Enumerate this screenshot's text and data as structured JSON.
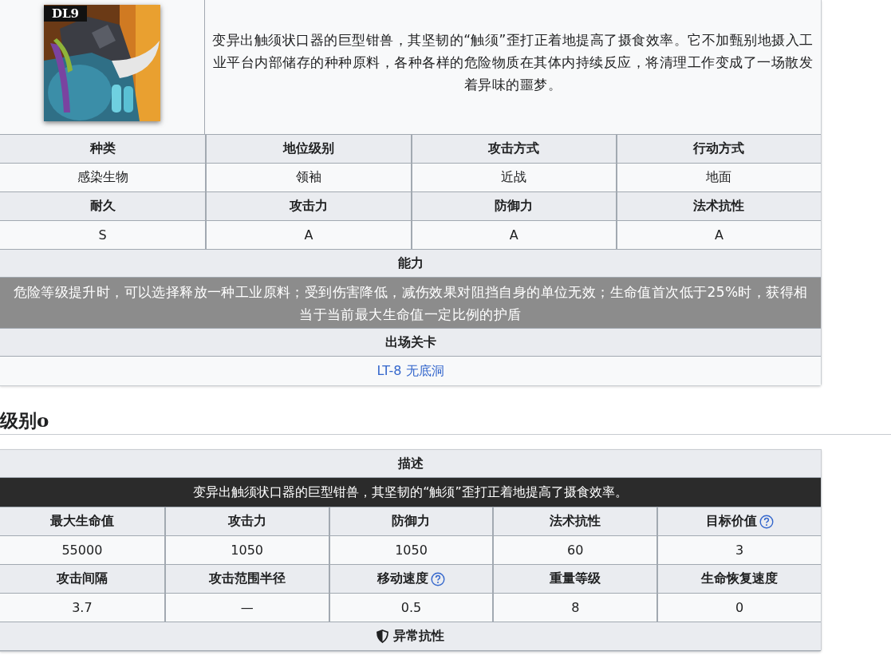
{
  "info_table": {
    "portrait": {
      "badge": "DL9"
    },
    "description": "变异出触须状口器的巨型钳兽，其坚韧的“触须”歪打正着地提高了摄食效率。它不加甄别地摄入工业平台内部储存的种种原料，各种各样的危险物质在其体内持续反应，将清理工作变成了一场散发着异味的噩梦。",
    "rows": [
      {
        "kind": "header",
        "cells": [
          "种类",
          "地位级别",
          "攻击方式",
          "行动方式"
        ]
      },
      {
        "kind": "value",
        "cells": [
          "感染生物",
          "领袖",
          "近战",
          "地面"
        ]
      },
      {
        "kind": "header",
        "cells": [
          "耐久",
          "攻击力",
          "防御力",
          "法术抗性"
        ]
      },
      {
        "kind": "value",
        "cells": [
          "S",
          "A",
          "A",
          "A"
        ]
      }
    ],
    "ability": {
      "title": "能力",
      "text": "危险等级提升时，可以选择释放一种工业原料；受到伤害降低，减伤效果对阻挡自身的单位无效；生命值首次低于25%时，获得相当于当前最大生命值一定比例的护盾"
    },
    "stage": {
      "title": "出场关卡",
      "link": "LT-8 无底洞"
    }
  },
  "level_heading": "级别o",
  "level_table": {
    "description_title": "描述",
    "description": "变异出触须状口器的巨型钳兽，其坚韧的“触须”歪打正着地提高了摄食效率。",
    "rows": [
      {
        "kind": "header",
        "cells": [
          {
            "text": "最大生命值",
            "help": false
          },
          {
            "text": "攻击力",
            "help": false
          },
          {
            "text": "防御力",
            "help": false
          },
          {
            "text": "法术抗性",
            "help": false
          },
          {
            "text": "目标价值",
            "help": true
          }
        ]
      },
      {
        "kind": "value",
        "cells": [
          {
            "text": "55000",
            "help": false
          },
          {
            "text": "1050",
            "help": false
          },
          {
            "text": "1050",
            "help": false
          },
          {
            "text": "60",
            "help": false
          },
          {
            "text": "3",
            "help": false
          }
        ]
      },
      {
        "kind": "header",
        "cells": [
          {
            "text": "攻击间隔",
            "help": false
          },
          {
            "text": "攻击范围半径",
            "help": false
          },
          {
            "text": "移动速度",
            "help": true
          },
          {
            "text": "重量等级",
            "help": false
          },
          {
            "text": "生命恢复速度",
            "help": false
          }
        ]
      },
      {
        "kind": "value",
        "cells": [
          {
            "text": "3.7",
            "help": false
          },
          {
            "text": "—",
            "help": false
          },
          {
            "text": "0.5",
            "help": false
          },
          {
            "text": "8",
            "help": false
          },
          {
            "text": "0",
            "help": false
          }
        ]
      }
    ],
    "resistance_title": "异常抗性"
  }
}
